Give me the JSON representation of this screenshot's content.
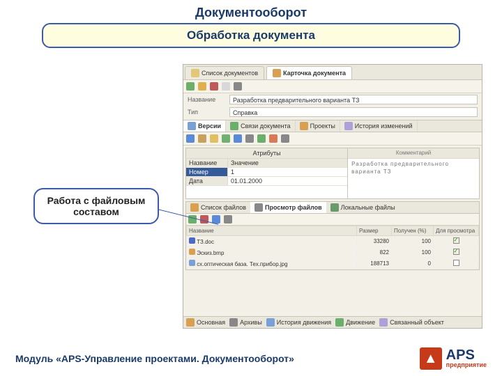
{
  "title": "Документооборот",
  "subtitle": "Обработка документа",
  "callout": "Работа с файловым составом",
  "footer": "Модуль «APS-Управление проектами. Документооборот»",
  "logo": {
    "mark": "▲",
    "text": "APS",
    "sub": "предприятие"
  },
  "app": {
    "tabs": [
      {
        "label": "Список документов",
        "active": false
      },
      {
        "label": "Карточка документа",
        "active": true
      }
    ],
    "fields": {
      "name_label": "Название",
      "name_value": "Разработка предварительного варианта ТЗ",
      "type_label": "Тип",
      "type_value": "Справка"
    },
    "subtabs": [
      {
        "label": "Версии"
      },
      {
        "label": "Связи документа"
      },
      {
        "label": "Проекты"
      },
      {
        "label": "История изменений"
      }
    ],
    "panels": {
      "attributes_header": "Атрибуты",
      "comment_header": "Комментарий",
      "comment_text": "Разработка предварительного варианта ТЗ",
      "grid_name_label": "Название",
      "grid_value_label": "Значение",
      "rows": [
        {
          "label": "Номер",
          "value": "1",
          "selected": true
        },
        {
          "label": "Дата",
          "value": "01.01.2000",
          "selected": false
        }
      ]
    },
    "files": {
      "tabs": [
        {
          "label": "Список файлов"
        },
        {
          "label": "Просмотр файлов",
          "active": true
        },
        {
          "label": "Локальные файлы"
        }
      ],
      "columns": [
        "Название",
        "Размер",
        "Получен (%)",
        "Для просмотра"
      ],
      "rows": [
        {
          "name": "ТЗ.doc",
          "size": "33280",
          "percent": "100",
          "checked": true
        },
        {
          "name": "Эскиз.bmp",
          "size": "822",
          "percent": "100",
          "checked": true
        },
        {
          "name": "сх.оптическая база. Тех.прибор.jpg",
          "size": "188713",
          "percent": "0",
          "checked": false
        }
      ]
    },
    "bottombar": [
      "Основная",
      "Архивы",
      "История движения",
      "Движение",
      "Связанный объект"
    ]
  }
}
